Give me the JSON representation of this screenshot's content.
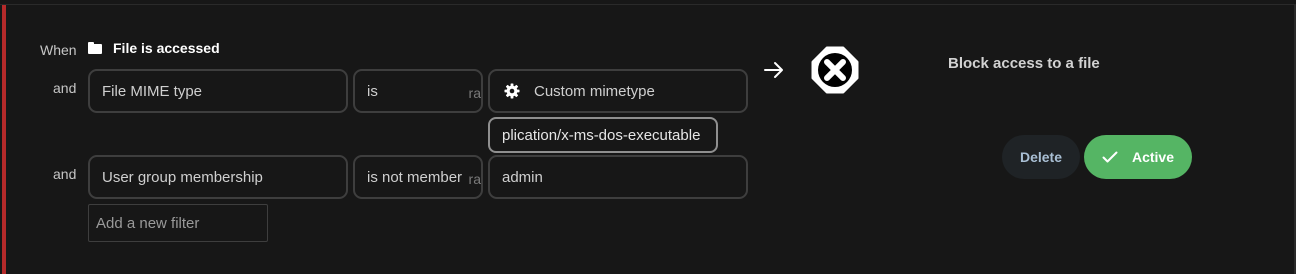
{
  "rule": {
    "when_label": "When",
    "event": {
      "icon": "folder-icon",
      "label": "File is accessed"
    },
    "conditions": [
      {
        "connector": "and",
        "field": "File MIME type",
        "operator": "is",
        "operator_ghost": "ra",
        "value_icon": "gear-icon",
        "value": "Custom mimetype",
        "custom_input": "plication/x-ms-dos-executable"
      },
      {
        "connector": "and",
        "field": "User group membership",
        "operator": "is not member",
        "operator_ghost": "ra",
        "value": "admin"
      }
    ],
    "add_filter_placeholder": "Add a new filter"
  },
  "action": {
    "arrow_icon": "arrow-right-icon",
    "icon": "block-x-icon",
    "title": "Block access to a file"
  },
  "buttons": {
    "delete_label": "Delete",
    "active_label": "Active",
    "active_icon": "check-icon"
  },
  "colors": {
    "accent_bar": "#b52a2a",
    "active_button": "#55b564",
    "delete_button_bg": "#1f2326",
    "background": "#171717"
  }
}
